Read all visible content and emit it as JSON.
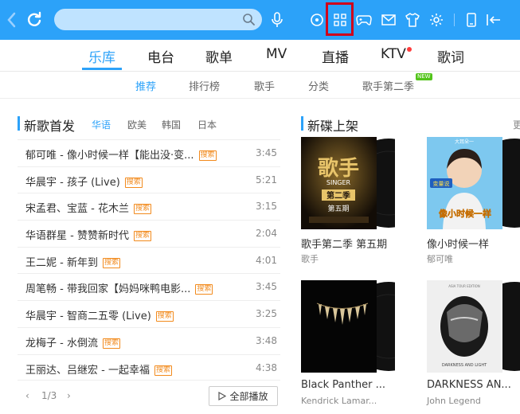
{
  "nav": {
    "tabs": [
      {
        "label": "乐库",
        "active": true
      },
      {
        "label": "电台",
        "active": false
      },
      {
        "label": "歌单",
        "active": false
      },
      {
        "label": "MV",
        "active": false
      },
      {
        "label": "直播",
        "active": false
      },
      {
        "label": "KTV",
        "active": false,
        "dot": true
      },
      {
        "label": "歌词",
        "active": false
      }
    ]
  },
  "subnav": {
    "tabs": [
      "推荐",
      "排行榜",
      "歌手",
      "分类",
      "歌手第二季"
    ],
    "new_badge": "NEW"
  },
  "new_songs": {
    "title": "新歌首发",
    "filters": [
      "华语",
      "欧美",
      "韩国",
      "日本"
    ],
    "badge_label": "搜索",
    "songs": [
      {
        "title": "郁可唯 - 像小时候一样【能出没·变...",
        "duration": "3:45"
      },
      {
        "title": "华晨宇 - 孩子 (Live)",
        "duration": "5:21"
      },
      {
        "title": "宋孟君、宝蓝 - 花木兰",
        "duration": "3:15"
      },
      {
        "title": "华语群星 - 赞赞新时代",
        "duration": "2:04"
      },
      {
        "title": "王二妮 - 新年到",
        "duration": "4:01"
      },
      {
        "title": "周笔畅 - 带我回家【妈妈咪鸭电影...",
        "duration": "3:45"
      },
      {
        "title": "华晨宇 - 智商二五零 (Live)",
        "duration": "3:25"
      },
      {
        "title": "龙梅子 - 水倒流",
        "duration": "3:48"
      },
      {
        "title": "王丽达、吕继宏 - 一起幸福",
        "duration": "4:38"
      }
    ],
    "pager": "1/3",
    "play_all": "全部播放"
  },
  "new_albums": {
    "title": "新碟上架",
    "more": "更",
    "albums": [
      {
        "name": "歌手第二季 第五期",
        "artist": "歌手"
      },
      {
        "name": "像小时候一样",
        "artist": "郁可唯"
      },
      {
        "name": "Black Panther ...",
        "artist": "Kendrick Lamar..."
      },
      {
        "name": "DARKNESS AN...",
        "artist": "John Legend"
      }
    ],
    "cover_text": {
      "singer": "歌手",
      "singer_en": "SINGER",
      "season": "第二季",
      "episode": "第五期",
      "kid_title": "像小时候一样",
      "kid_top": "大耳朵一",
      "kid_badge": "变量说",
      "tour": "ASIA TOUR EDITION",
      "darkness": "DARKNESS AND LIGHT"
    }
  },
  "colors": {
    "accent": "#2ca2f9",
    "highlight": "#d0021b",
    "badge": "#f28a1c",
    "new_badge": "#52c41a"
  },
  "icons": [
    "back-icon",
    "refresh-icon",
    "search-icon",
    "mic-icon",
    "radio-icon",
    "grid-apps-icon",
    "gamepad-icon",
    "mail-icon",
    "shirt-icon",
    "settings-icon",
    "phone-icon",
    "exit-icon"
  ]
}
